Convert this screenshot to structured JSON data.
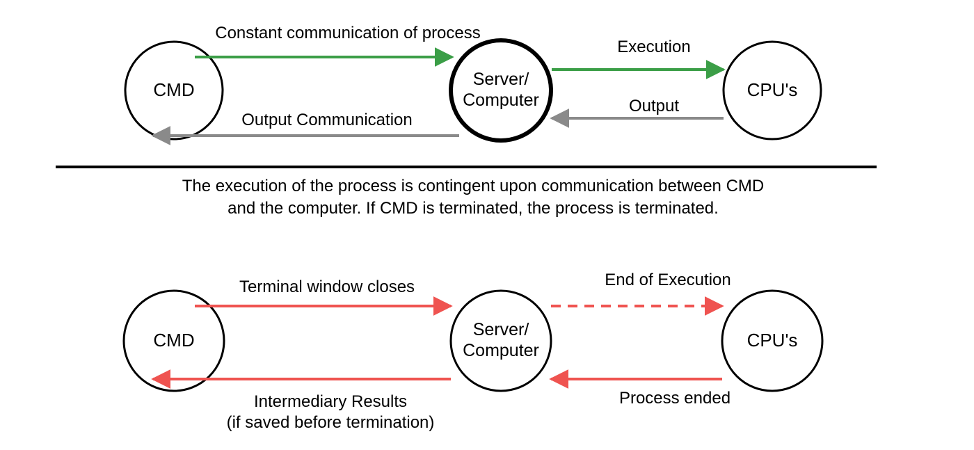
{
  "colors": {
    "green": "#3b9e47",
    "gray": "#8a8a8a",
    "red": "#ef5350",
    "black": "#000000"
  },
  "top": {
    "nodes": {
      "cmd": "CMD",
      "server_line1": "Server/",
      "server_line2": "Computer",
      "cpus": "CPU's"
    },
    "arrows": {
      "comm": "Constant communication of process",
      "execution": "Execution",
      "output": "Output",
      "output_comm": "Output Communication"
    }
  },
  "caption": {
    "line1": "The execution of the process is contingent upon communication between CMD",
    "line2": "and the computer. If CMD is terminated, the process is terminated."
  },
  "bottom": {
    "nodes": {
      "cmd": "CMD",
      "server_line1": "Server/",
      "server_line2": "Computer",
      "cpus": "CPU's"
    },
    "arrows": {
      "terminal_close": "Terminal window closes",
      "end_exec": "End of Execution",
      "process_ended": "Process ended",
      "inter_line1": "Intermediary Results",
      "inter_line2": "(if saved before termination)"
    }
  }
}
